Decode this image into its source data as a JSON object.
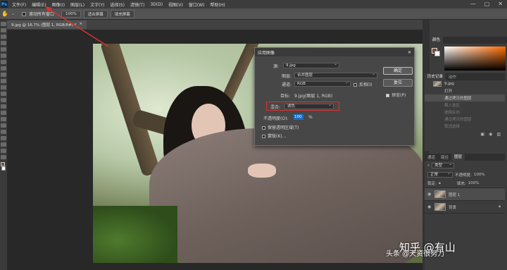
{
  "app": {
    "logo": "Ps"
  },
  "menu": [
    "文件(F)",
    "编辑(E)",
    "图像(I)",
    "图层(L)",
    "文字(Y)",
    "选择(S)",
    "滤镜(T)",
    "3D(D)",
    "视图(V)",
    "窗口(W)",
    "帮助(H)"
  ],
  "window_controls": {
    "minimize": "—",
    "maximize": "▢",
    "close": "✕"
  },
  "options_bar": {
    "scroll_all_windows": "滚动所有窗口",
    "zoom_100": "100%",
    "fit_screen": "适合屏幕",
    "fill_screen": "填充屏幕"
  },
  "document_tab": {
    "title": "9.jpg @ 16.7% (图层 1, RGB/8#) *",
    "close": "×"
  },
  "panels": {
    "color_tab": "颜色",
    "history_tab": "历史记录",
    "actions_tab": "动作",
    "history_doc": "9.jpg",
    "history_items": [
      {
        "label": "打开",
        "state": "normal"
      },
      {
        "label": "通过拷贝的图层",
        "state": "selected"
      },
      {
        "label": "载入选区",
        "state": "dim"
      },
      {
        "label": "选择反向",
        "state": "dim"
      },
      {
        "label": "通过拷贝的图层",
        "state": "dim"
      },
      {
        "label": "取消选择",
        "state": "dim"
      }
    ],
    "layers_tabs": [
      "通道",
      "路径",
      "图层"
    ],
    "layers_filter": "类型",
    "layers_blend": "正常",
    "layers_opacity_label": "不透明度:",
    "layers_opacity": "100%",
    "layers_lock_label": "锁定:",
    "layers_fill_label": "填充:",
    "layers_fill": "100%",
    "layers": [
      {
        "name": "图层 1",
        "selected": true
      },
      {
        "name": "背景",
        "selected": false,
        "locked": true
      }
    ]
  },
  "dialog": {
    "title": "应用图像",
    "source_label": "源:",
    "source_value": "9.jpg",
    "layer_label": "图层:",
    "layer_value": "合并图层",
    "channel_label": "通道:",
    "channel_value": "RGB",
    "invert_label": "反相(I)",
    "target_label": "目标:",
    "target_value": "9.jpg(图层 1, RGB)",
    "blending_label": "混合:",
    "blending_value": "滤色",
    "opacity_label": "不透明度(O):",
    "opacity_value": "100",
    "opacity_unit": "%",
    "preserve_transparency": "保留透明区域(T)",
    "mask": "蒙版(K)...",
    "ok": "确定",
    "reset": "复位",
    "preview": "预览(P)",
    "preview_checked": true,
    "highlight_color": "#d9322f"
  },
  "watermark": {
    "line1": "知乎 @有山",
    "line2": "头条 @天资很努力"
  }
}
